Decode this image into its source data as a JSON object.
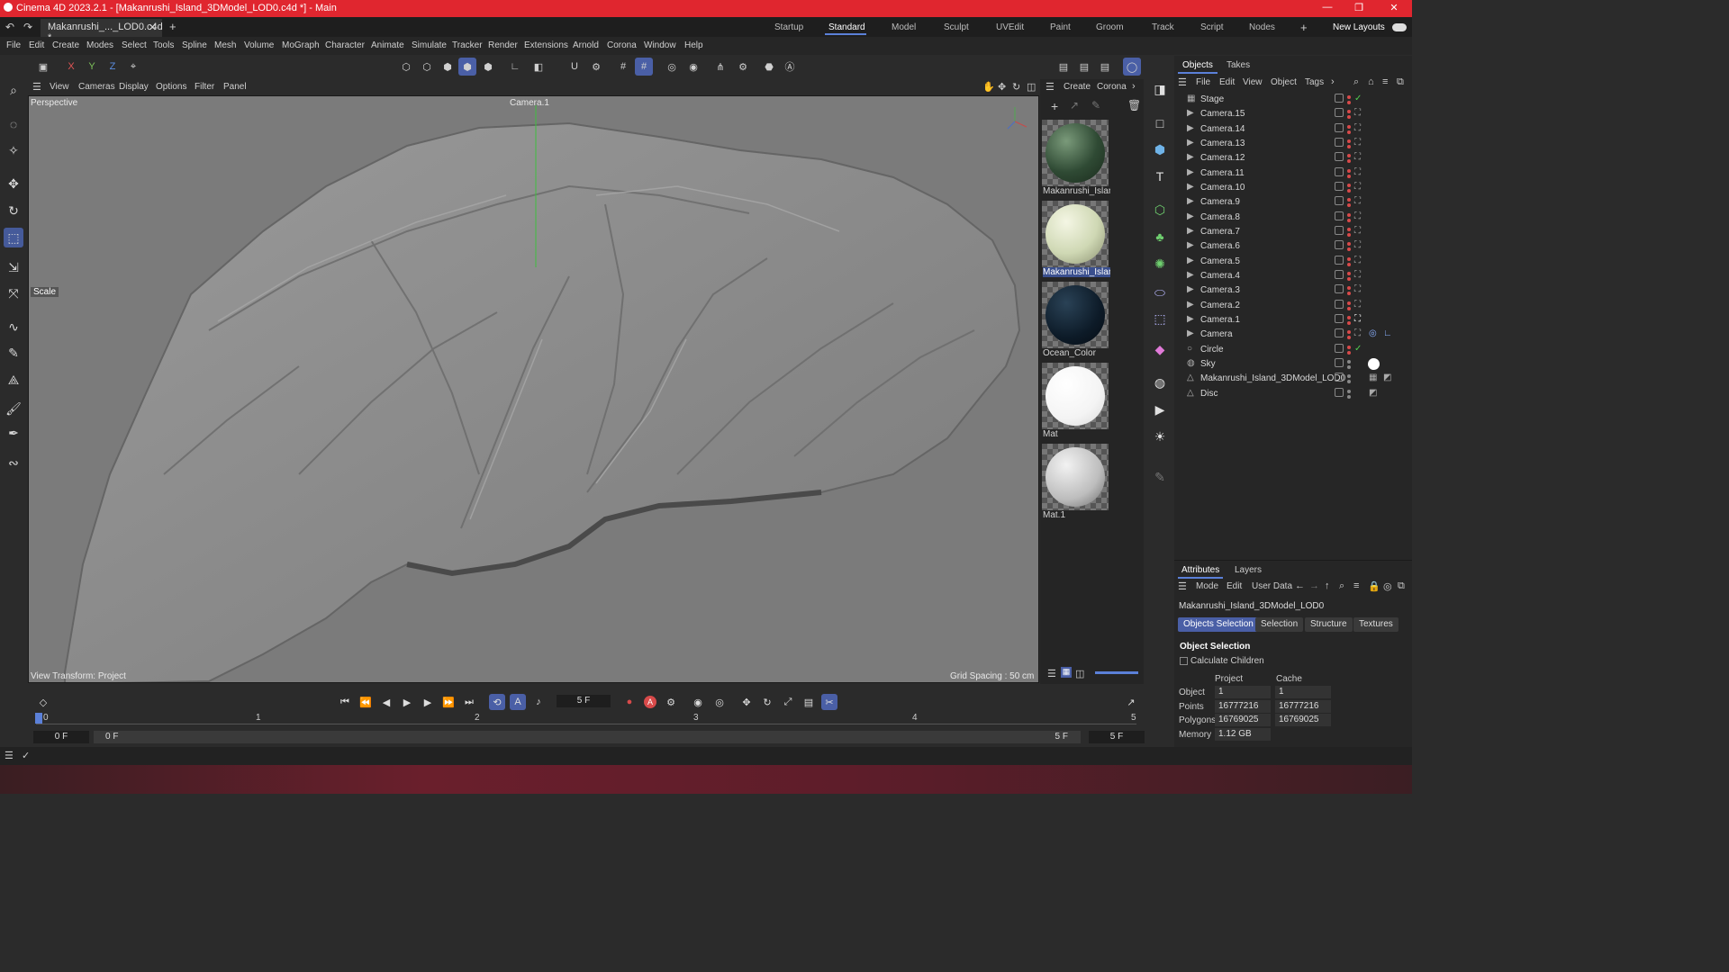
{
  "window": {
    "title": "Cinema 4D 2023.2.1 - [Makanrushi_Island_3DModel_LOD0.c4d *] - Main",
    "doc_tab": "Makanrushi_..._LOD0.c4d *"
  },
  "layouts": {
    "tabs": [
      "Startup",
      "Standard",
      "Model",
      "Sculpt",
      "UVEdit",
      "Paint",
      "Groom",
      "Track",
      "Script",
      "Nodes"
    ],
    "active": "Standard",
    "new_layouts": "New Layouts"
  },
  "menu": [
    "File",
    "Edit",
    "Create",
    "Modes",
    "Select",
    "Tools",
    "Spline",
    "Mesh",
    "Volume",
    "MoGraph",
    "Character",
    "Animate",
    "Simulate",
    "Tracker",
    "Render",
    "Extensions",
    "Arnold",
    "Corona",
    "Window",
    "Help"
  ],
  "axis_buttons": [
    "X",
    "Y",
    "Z"
  ],
  "viewport": {
    "menu": [
      "View",
      "Cameras",
      "Display",
      "Options",
      "Filter",
      "Panel"
    ],
    "projection": "Perspective",
    "camera": "Camera.1",
    "tool_label": "Scale",
    "view_transform": "View Transform: Project",
    "grid_spacing": "Grid Spacing : 50 cm"
  },
  "materials": {
    "menu": [
      "Create",
      "Corona"
    ],
    "items": [
      {
        "name": "Makanrushi_Island",
        "color": "#3a5a40"
      },
      {
        "name": "Makanrushi_Island",
        "color": "#d8dfc0"
      },
      {
        "name": "Ocean_Color",
        "color": "#0f1e2c"
      },
      {
        "name": "Mat",
        "color": "#ffffff"
      },
      {
        "name": "Mat.1",
        "color": "#bdbdbd"
      }
    ],
    "selected_index": 1
  },
  "objects": {
    "tabs": [
      "Objects",
      "Takes"
    ],
    "menu": [
      "File",
      "Edit",
      "View",
      "Object",
      "Tags"
    ],
    "rows": [
      "Stage",
      "Camera.15",
      "Camera.14",
      "Camera.13",
      "Camera.12",
      "Camera.11",
      "Camera.10",
      "Camera.9",
      "Camera.8",
      "Camera.7",
      "Camera.6",
      "Camera.5",
      "Camera.4",
      "Camera.3",
      "Camera.2",
      "Camera.1",
      "Camera",
      "Circle",
      "Sky",
      "Makanrushi_Island_3DModel_LOD0",
      "Disc"
    ]
  },
  "attributes": {
    "tabs": [
      "Attributes",
      "Layers"
    ],
    "menu": [
      "Mode",
      "Edit",
      "User Data"
    ],
    "object_name": "Makanrushi_Island_3DModel_LOD0",
    "subtabs": [
      "Objects Selection",
      "Selection",
      "Structure",
      "Textures"
    ],
    "section": "Object Selection",
    "calc_children": "Calculate Children",
    "col_project": "Project",
    "col_cache": "Cache",
    "rows": [
      {
        "label": "Object",
        "project": "1",
        "cache": "1"
      },
      {
        "label": "Points",
        "project": "16777216",
        "cache": "16777216"
      },
      {
        "label": "Polygons",
        "project": "16769025",
        "cache": "16769025"
      },
      {
        "label": "Memory",
        "project": "1.12 GB",
        "cache": ""
      }
    ]
  },
  "timeline": {
    "current_frame": "5 F",
    "ruler": [
      "0",
      "1",
      "2",
      "3",
      "4",
      "5"
    ],
    "start": "0 F",
    "start2": "0 F",
    "end": "5 F",
    "end2": "5 F"
  },
  "colors": {
    "titlebar": "#e0262f",
    "accent": "#4a5fa6"
  }
}
